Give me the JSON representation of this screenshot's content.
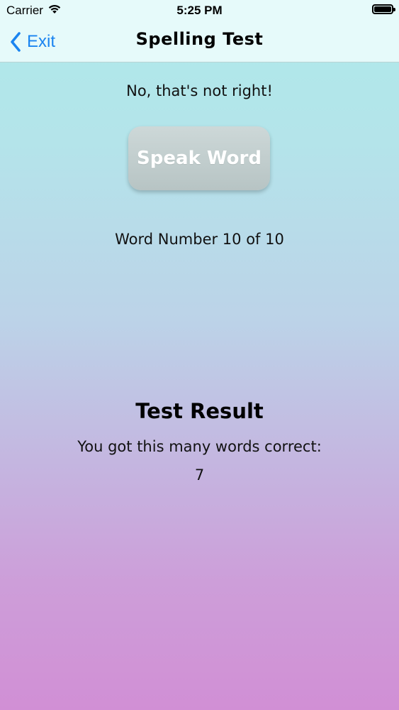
{
  "status_bar": {
    "carrier": "Carrier",
    "time": "5:25 PM",
    "wifi_icon": "wifi-icon",
    "battery_icon": "battery-full-icon"
  },
  "nav": {
    "back_label": "Exit",
    "back_icon": "chevron-left-icon",
    "title": "Spelling Test"
  },
  "main": {
    "feedback": "No, that's not right!",
    "speak_button_label": "Speak Word",
    "word_number": "Word Number 10 of 10"
  },
  "result": {
    "title": "Test Result",
    "label": "You got this many words correct:",
    "value": "7"
  },
  "colors": {
    "accent": "#1a84f0",
    "gradient_top": "#aeeaea",
    "gradient_bottom": "#d18fd5",
    "button_bg": "#c4cfcf"
  }
}
